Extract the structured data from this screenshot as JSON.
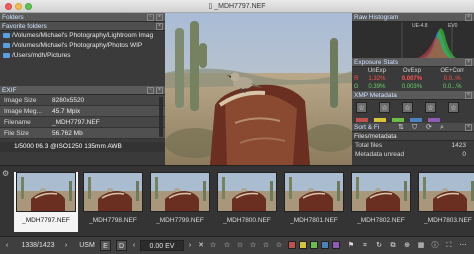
{
  "window": {
    "title": "_MDH7797.NEF"
  },
  "left": {
    "folders_title": "Folders",
    "favorites_title": "Favorite folders",
    "favorites": [
      "/Volumes/Michael's Photography/Lightroom Imag",
      "/Volumes/Michael's Photography/Photos WIP",
      "/Users/mdh/Pictures"
    ],
    "exif_title": "EXIF",
    "exif": [
      {
        "k": "Image Size",
        "v": "8280x5520"
      },
      {
        "k": "Image Meg...",
        "v": "45.7 Mpix"
      },
      {
        "k": "Filename",
        "v": "_MDH7797.NEF"
      },
      {
        "k": "File Size",
        "v": "56.762 Mb"
      }
    ],
    "summary": "1/5000 f/6.3 @ISO1250 135mm AWB"
  },
  "right": {
    "histogram_title": "Raw Histogram",
    "hist_labels": {
      "ev_left": "UE-4.8",
      "ev_right": "EV0"
    },
    "exposure_title": "Exposure Stats",
    "expo_headers": [
      "UnExp",
      "OvExp",
      "OE+Corr"
    ],
    "expo_rows": [
      {
        "ch": "R",
        "a": "1.32%",
        "b": "0.007%",
        "c": "0.0..%"
      },
      {
        "ch": "G",
        "a": "0.39%",
        "b": "0.003%",
        "c": "0.0...%"
      }
    ],
    "xmp_title": "XMP Metadata",
    "sort_title": "Sort & Fi",
    "files_title": "Files/metadata",
    "files": [
      {
        "k": "Total files",
        "v": "1423"
      },
      {
        "k": "Metadata unread",
        "v": "0"
      }
    ]
  },
  "filmstrip": [
    {
      "name": "_MDH7797.NEF",
      "selected": true
    },
    {
      "name": "_MDH7798.NEF",
      "selected": false
    },
    {
      "name": "_MDH7799.NEF",
      "selected": false
    },
    {
      "name": "_MDH7800.NEF",
      "selected": false
    },
    {
      "name": "_MDH7801.NEF",
      "selected": false
    },
    {
      "name": "_MDH7802.NEF",
      "selected": false
    },
    {
      "name": "_MDH7803.NEF",
      "selected": false
    }
  ],
  "toolbar": {
    "counter": "1338/1423",
    "usm": "USM",
    "e_label": "E",
    "d_label": "D",
    "ev_value": "0.00 EV",
    "color_swatches": [
      "#c0504d",
      "#d8c43a",
      "#6bbd4a",
      "#4f81bd",
      "#8e5bb5"
    ]
  },
  "colors": {
    "accent": "#cfe3ff",
    "panel": "#5a5a5a",
    "selected_thumb": "#f4f4f4"
  }
}
